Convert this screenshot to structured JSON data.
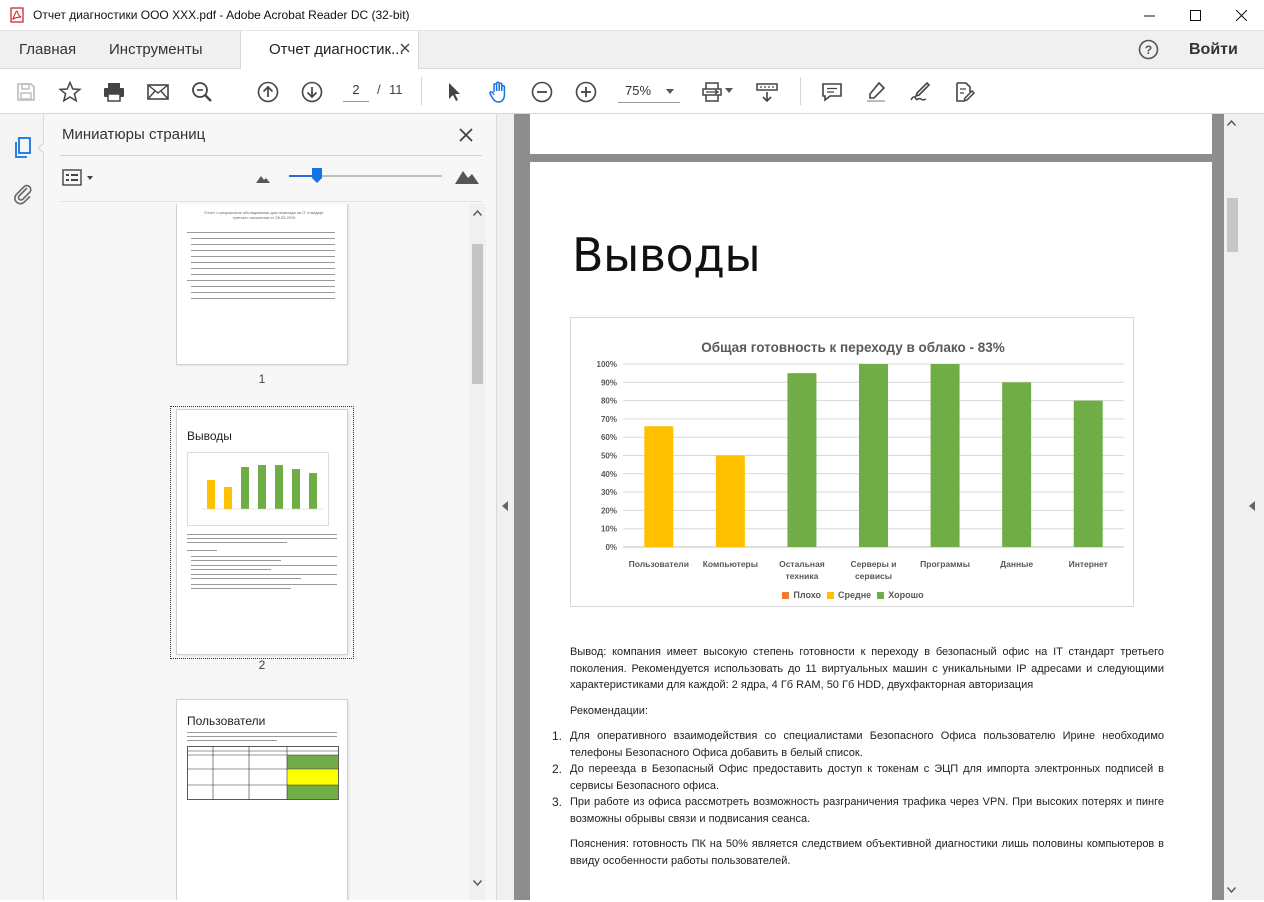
{
  "window": {
    "title": "Отчет диагностики ООО ХХХ.pdf - Adobe Acrobat Reader DC (32-bit)"
  },
  "menu": {
    "home": "Главная",
    "tools": "Инструменты",
    "doc_tab": "Отчет диагностик...",
    "login": "Войти"
  },
  "toolbar": {
    "page_current": "2",
    "page_sep": "/",
    "page_total": "11",
    "zoom": "75%"
  },
  "panel": {
    "title": "Миниатюры страниц",
    "thumbs": [
      {
        "number": "1",
        "heading": "Отчет о результатах обследования для перехода на IT стандарт третьего поколения от 28.05.2019"
      },
      {
        "number": "2",
        "heading": "Выводы"
      },
      {
        "heading": "Пользователи"
      }
    ]
  },
  "page": {
    "heading": "Выводы",
    "conclusion": "Вывод: компания имеет высокую степень готовности к переходу в безопасный офис на IT стандарт третьего поколения. Рекомендуется использовать до 11 виртуальных машин с уникальными IP адресами и следующими характеристиками для каждой: 2 ядра, 4 Гб RAM, 50 Гб HDD, двухфакторная авторизация",
    "recs_label": "Рекомендации:",
    "recs": [
      {
        "n": "1.",
        "text": "Для оперативного взаимодействия со специалистами Безопасного Офиса пользователю Ирине необходимо телефоны Безопасного Офиса добавить в белый список."
      },
      {
        "n": "2.",
        "text": "До переезда в Безопасный Офис предоставить доступ к токенам с ЭЦП для импорта электронных подписей в сервисы Безопасного офиса."
      },
      {
        "n": "3.",
        "text": "При работе из офиса рассмотреть возможность разграничения трафика через VPN. При высоких потерях и пинге возможны обрывы связи и подвисания сеанса."
      }
    ],
    "note": "Пояснения: готовность ПК на 50% является следствием объективной диагностики лишь половины компьютеров в ввиду особенности работы пользователей."
  },
  "colors": {
    "bad": "#ED7D31",
    "medium": "#FFC000",
    "good": "#70AD47"
  },
  "chart_data": {
    "type": "bar",
    "title": "Общая готовность к переходу в облако - 83%",
    "categories": [
      "Пользователи",
      "Компьютеры",
      "Остальная техника",
      "Серверы и сервисы",
      "Программы",
      "Данные",
      "Интернет"
    ],
    "category_lines": [
      [
        "Пользователи"
      ],
      [
        "Компьютеры"
      ],
      [
        "Остальная",
        "техника"
      ],
      [
        "Серверы и",
        "сервисы"
      ],
      [
        "Программы"
      ],
      [
        "Данные"
      ],
      [
        "Интернет"
      ]
    ],
    "values": [
      66,
      50,
      95,
      100,
      100,
      90,
      80
    ],
    "bar_groups": [
      "Средне",
      "Средне",
      "Хорошо",
      "Хорошо",
      "Хорошо",
      "Хорошо",
      "Хорошо"
    ],
    "legend": [
      {
        "name": "Плохо",
        "color": "#ED7D31"
      },
      {
        "name": "Средне",
        "color": "#FFC000"
      },
      {
        "name": "Хорошо",
        "color": "#70AD47"
      }
    ],
    "yticks": [
      "0%",
      "10%",
      "20%",
      "30%",
      "40%",
      "50%",
      "60%",
      "70%",
      "80%",
      "90%",
      "100%"
    ],
    "ylim": [
      0,
      100
    ],
    "grid": true,
    "legend_position": "bottom"
  }
}
